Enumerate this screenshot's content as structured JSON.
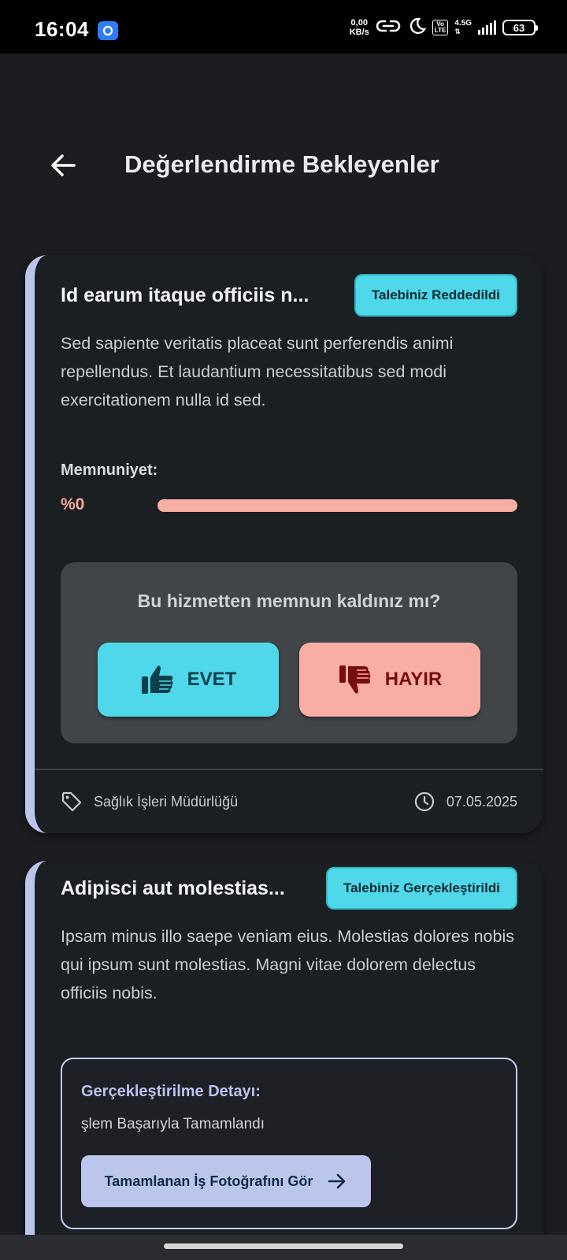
{
  "status_bar": {
    "time": "16:04",
    "net_speed_value": "0,00",
    "net_speed_unit": "KB/s",
    "volte_top": "Vo",
    "volte_bottom": "LTE",
    "network_type": "4.5G",
    "battery": "63"
  },
  "app_bar": {
    "title": "Değerlendirme Bekleyenler"
  },
  "requests": [
    {
      "title": "Id earum itaque officiis n...",
      "status": "Talebiniz Reddedildi",
      "description": "Sed sapiente veritatis placeat sunt perferendis animi repellendus. Et laudantium necessitatibus sed modi exercitationem nulla id sed.",
      "satisfaction": {
        "label": "Memnuniyet:",
        "value_text": "%0",
        "value": 0
      },
      "feedback": {
        "question": "Bu hizmetten memnun kaldınız mı?",
        "yes_label": "EVET",
        "no_label": "HAYIR"
      },
      "department": "Sağlık İşleri Müdürlüğü",
      "date": "07.05.2025"
    },
    {
      "title": "Adipisci aut molestias...",
      "status": "Talebiniz Gerçekleştirildi",
      "description": "Ipsam minus illo saepe veniam eius. Molestias dolores nobis qui ipsum sunt molestias. Magni vitae dolorem delectus officiis nobis.",
      "completion": {
        "title": "Gerçekleştirilme Detayı:",
        "text": "şlem Başarıyla Tamamlandı",
        "photo_button": "Tamamlanan İş Fotoğrafını Gör"
      }
    }
  ],
  "colors": {
    "accent_cyan": "#4fd8e9",
    "accent_salmon": "#f8aea3",
    "card_border": "#bcc5ec",
    "background": "#1b1d20"
  }
}
